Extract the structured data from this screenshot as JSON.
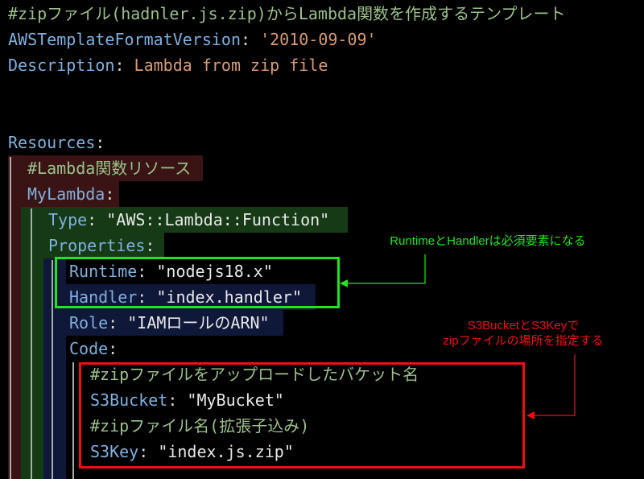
{
  "code": {
    "lines": [
      {
        "comment": "#zipファイル(hadnler.js.zip)からLambda関数を作成するテンプレート"
      },
      {
        "key": "AWSTemplateFormatVersion",
        "value": "'2010-09-09'"
      },
      {
        "key": "Description",
        "value": "Lambda from zip file"
      },
      {
        "key": "Resources"
      },
      {
        "comment": "#Lambda関数リソース"
      },
      {
        "key": "MyLambda"
      },
      {
        "key": "Type",
        "value": "\"AWS::Lambda::Function\""
      },
      {
        "key": "Properties"
      },
      {
        "key": "Runtime",
        "value": "\"nodejs18.x\""
      },
      {
        "key": "Handler",
        "value": "\"index.handler\""
      },
      {
        "key": "Role",
        "value": "\"IAMロールのARN\""
      },
      {
        "key": "Code"
      },
      {
        "comment": "#zipファイルをアップロードしたバケット名"
      },
      {
        "key": "S3Bucket",
        "value": "\"MyBucket\""
      },
      {
        "comment": "#zipファイル名(拡張子込み)"
      },
      {
        "key": "S3Key",
        "value": "\"index.js.zip\""
      }
    ],
    "colon": ":"
  },
  "annotations": {
    "green": {
      "text": "RuntimeとHandlerは必須要素になる",
      "color": "#1ee61e"
    },
    "red": {
      "line1": "S3BucketとS3Keyで",
      "line2": "zipファイルの場所を指定する",
      "color": "#ee1111"
    }
  }
}
